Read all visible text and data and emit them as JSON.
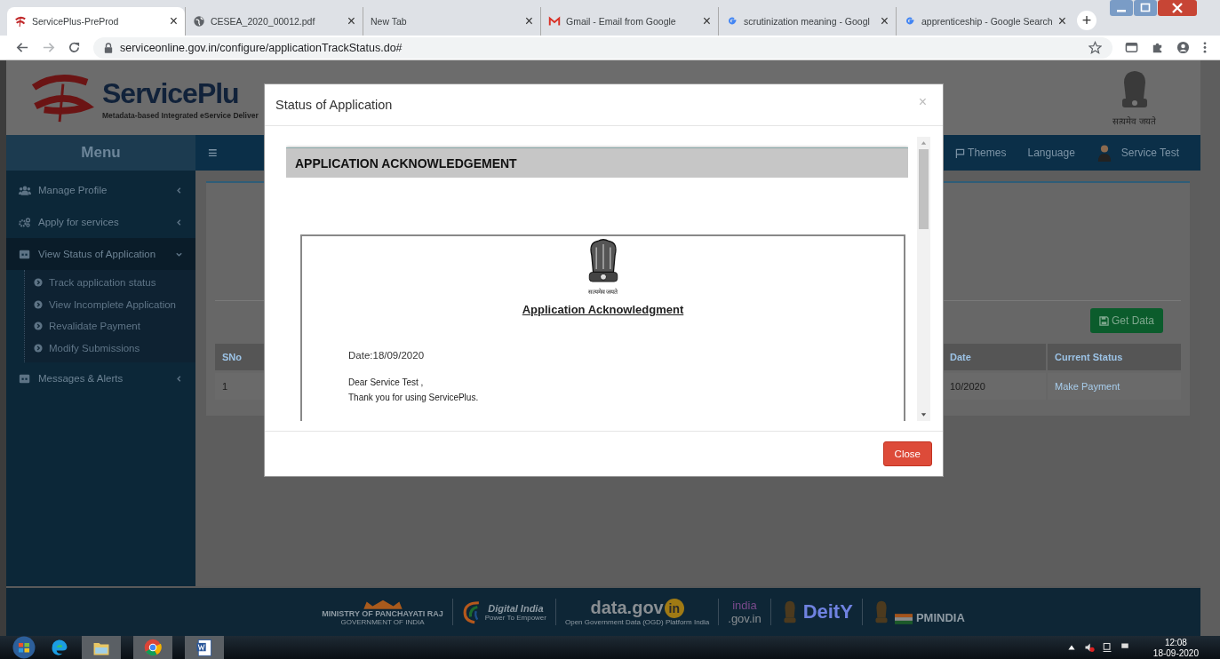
{
  "browser": {
    "tabs": [
      {
        "title": "ServicePlus-PreProd",
        "selected": true,
        "kind": "serviceplus"
      },
      {
        "title": "CESEA_2020_00012.pdf",
        "selected": false,
        "kind": "file"
      },
      {
        "title": "New Tab",
        "selected": false,
        "kind": "blank"
      },
      {
        "title": "Gmail - Email from Google",
        "selected": false,
        "kind": "mail"
      },
      {
        "title": "scrutinization meaning - Googl",
        "selected": false,
        "kind": "search"
      },
      {
        "title": "apprenticeship - Google Search",
        "selected": false,
        "kind": "search"
      }
    ],
    "close_glyph": "×",
    "new_tab_glyph": "+",
    "address": "serviceonline.gov.in/configure/applicationTrackStatus.do#"
  },
  "header": {
    "logo_text": "ServicePlu",
    "tagline": "Metadata-based Integrated eService Deliver",
    "emblem_caption": "सत्यमेव जयते"
  },
  "navbar": {
    "menu_title": "Menu",
    "toggle": "≡",
    "links": [
      "Themes",
      "Language"
    ],
    "user": "Service Test"
  },
  "sidebar": {
    "items": [
      {
        "label": "Manage Profile",
        "kind": "profile",
        "expanded": false
      },
      {
        "label": "Apply for services",
        "kind": "services",
        "expanded": false
      },
      {
        "label": "View Status of Application",
        "kind": "section",
        "expanded": true,
        "children": [
          {
            "label": "Track application status"
          },
          {
            "label": "View Incomplete Application"
          },
          {
            "label": "Revalidate Payment"
          },
          {
            "label": "Modify Submissions"
          }
        ]
      },
      {
        "label": "Messages & Alerts",
        "kind": "section",
        "expanded": false
      }
    ]
  },
  "content": {
    "button": "Get Data",
    "table": {
      "columns": [
        "SNo",
        "Date",
        "Current Status"
      ],
      "rows": [
        [
          "1",
          "10/2020",
          "Make Payment"
        ]
      ]
    }
  },
  "footer": {
    "logos": [
      {
        "kind": "panchayati",
        "title": "MINISTRY OF PANCHAYATI RAJ",
        "subtitle": "GOVERNMENT OF INDIA"
      },
      {
        "kind": "digital",
        "title": "Digital India",
        "subtitle": "Power To Empower"
      },
      {
        "kind": "datagov",
        "title": "data.gov",
        "badge": "in",
        "subtitle": "Open Government Data (OGD) Platform India"
      },
      {
        "kind": "indiagov",
        "title": "india",
        "subtitle": ".gov.in"
      },
      {
        "kind": "deity",
        "title": "DeitY"
      },
      {
        "kind": "pmindia",
        "title": "PMINDIA"
      }
    ]
  },
  "modal": {
    "title": "Status of Application",
    "close_glyph": "×",
    "panel_title": "APPLICATION ACKNOWLEDGEMENT",
    "emblem_caption": "सत्यमेव जयते",
    "doc_title": "Application Acknowledgment",
    "date": "Date:18/09/2020",
    "lines": [
      "Dear Service Test ,",
      "Thank you for using ServicePlus."
    ],
    "close_button": "Close"
  },
  "taskbar": {
    "time": "12:08",
    "date": "18-09-2020"
  }
}
